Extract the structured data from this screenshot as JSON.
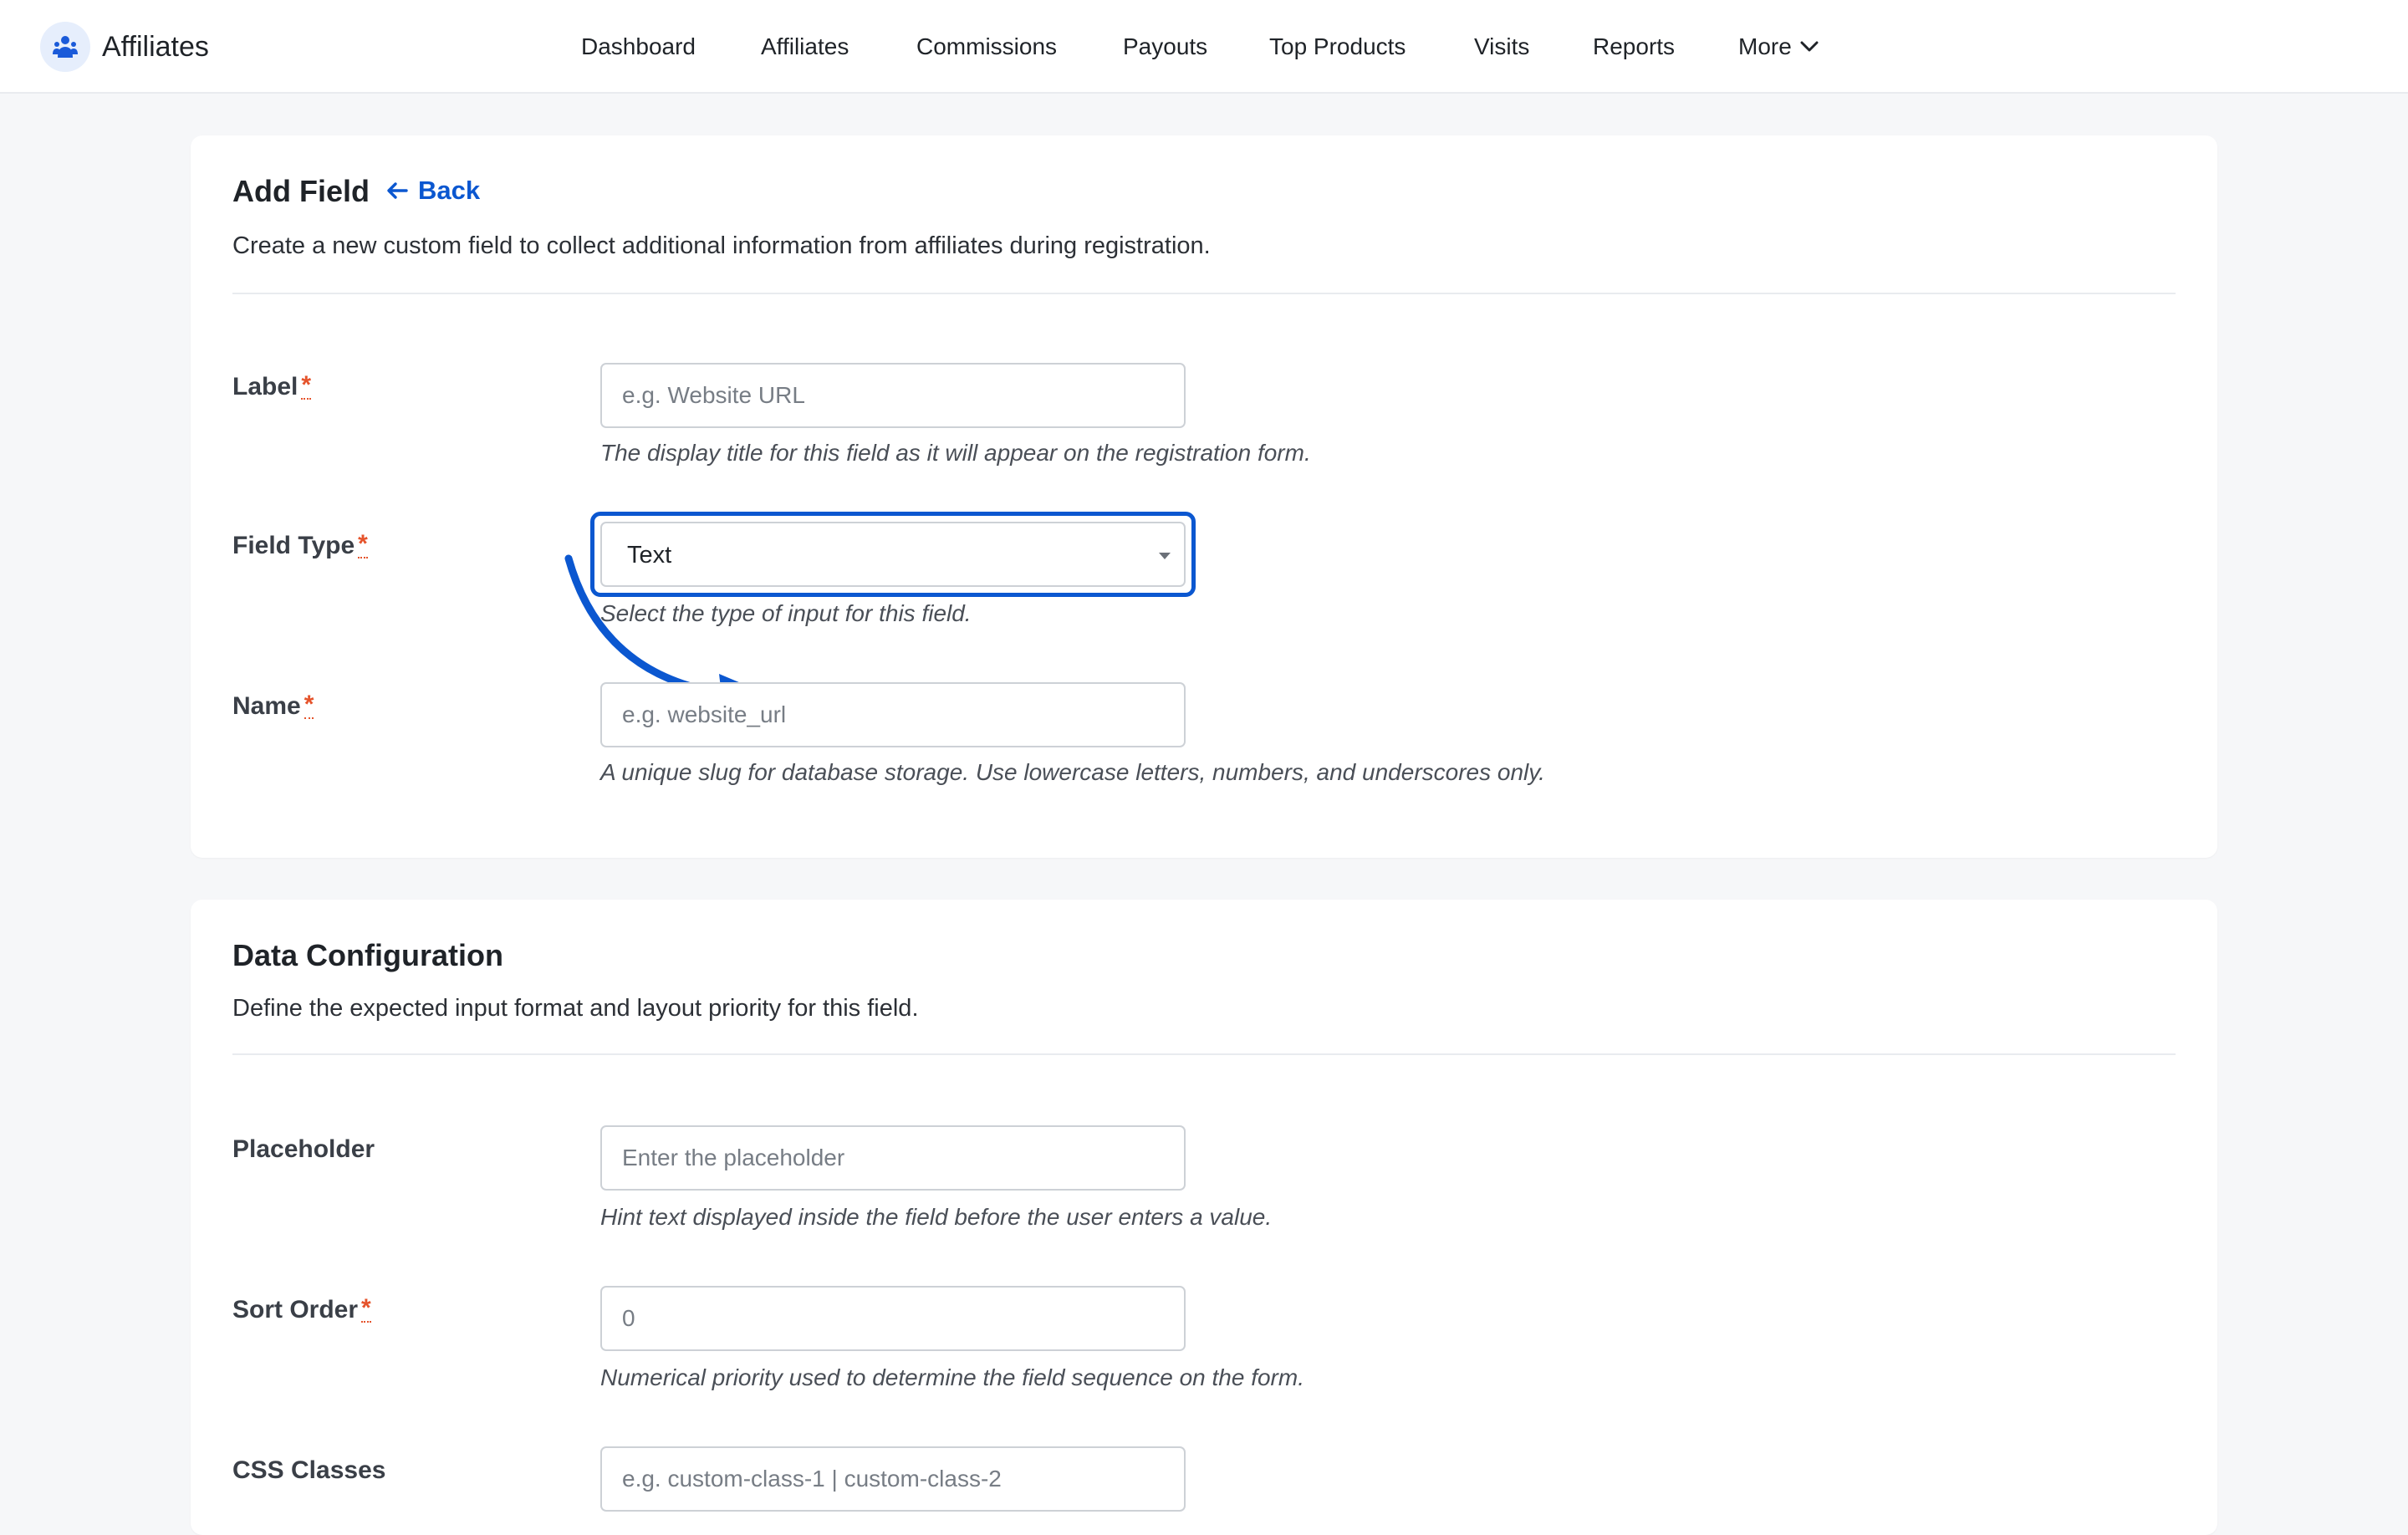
{
  "app": {
    "title": "Affiliates",
    "logo_icon": "affiliate-people-icon"
  },
  "nav": {
    "items": [
      {
        "label": "Dashboard"
      },
      {
        "label": "Affiliates"
      },
      {
        "label": "Commissions"
      },
      {
        "label": "Payouts"
      },
      {
        "label": "Top Products"
      },
      {
        "label": "Visits"
      },
      {
        "label": "Reports"
      },
      {
        "label": "More"
      }
    ]
  },
  "add_field": {
    "title": "Add Field",
    "back_label": "Back",
    "description": "Create a new custom field to collect additional information from affiliates during registration.",
    "fields": {
      "label": {
        "label": "Label",
        "required": "*",
        "value": "",
        "placeholder": "e.g. Website URL",
        "help": "The display title for this field as it will appear on the registration form."
      },
      "field_type": {
        "label": "Field Type",
        "required": "*",
        "value": "Text",
        "help": "Select the type of input for this field."
      },
      "name": {
        "label": "Name",
        "required": "*",
        "value": "",
        "placeholder": "e.g. website_url",
        "help": "A unique slug for database storage. Use lowercase letters, numbers, and underscores only."
      }
    }
  },
  "data_config": {
    "title": "Data Configuration",
    "description": "Define the expected input format and layout priority for this field.",
    "fields": {
      "placeholder": {
        "label": "Placeholder",
        "value": "",
        "placeholder": "Enter the placeholder",
        "help": "Hint text displayed inside the field before the user enters a value."
      },
      "sort_order": {
        "label": "Sort Order",
        "required": "*",
        "value": "",
        "placeholder": "0",
        "help": "Numerical priority used to determine the field sequence on the form."
      },
      "css_classes": {
        "label": "CSS Classes",
        "value": "",
        "placeholder": "e.g. custom-class-1 | custom-class-2"
      }
    }
  },
  "colors": {
    "accent": "#0b57d0",
    "required": "#e5532b",
    "background": "#f6f7f9"
  }
}
